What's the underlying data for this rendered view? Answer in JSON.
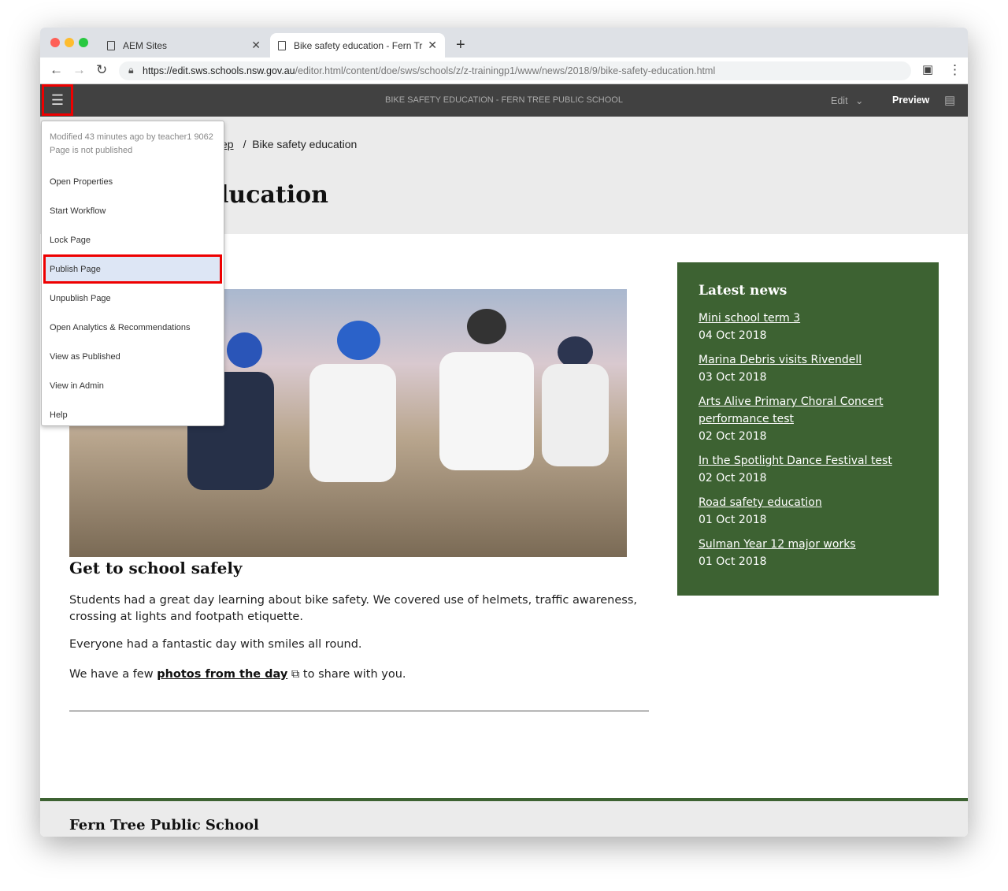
{
  "browser": {
    "tabs": [
      {
        "label": "AEM Sites"
      },
      {
        "label": "Bike safety education - Fern Tr"
      }
    ],
    "url_host": "https://edit.sws.schools.nsw.gov.au",
    "url_path": "/editor.html/content/doe/sws/schools/z/z-trainingp1/www/news/2018/9/bike-safety-education.html"
  },
  "aem": {
    "title": "BIKE SAFETY EDUCATION - FERN TREE PUBLIC SCHOOL",
    "edit_label": "Edit",
    "preview_label": "Preview"
  },
  "page_menu": {
    "modified": "Modified 43 minutes ago by teacher1 9062",
    "status": "Page is not published",
    "items": [
      "Open Properties",
      "Start Workflow",
      "Lock Page",
      "Publish Page",
      "Unpublish Page",
      "Open Analytics & Recommendations",
      "View as Published",
      "View in Admin",
      "Help"
    ]
  },
  "breadcrumb": {
    "parent_partial": "ep",
    "current": "Bike safety education"
  },
  "page": {
    "title_partial": "lucation",
    "subtitle": "Get to school safely",
    "p1": "Students had a great day learning about bike safety. We covered use of helmets, traffic awareness, crossing at lights and footpath etiquette.",
    "p2": "Everyone had a fantastic day with smiles all round.",
    "p3_pre": "We have a few ",
    "p3_link": "photos from the day",
    "p3_post": " to share with you."
  },
  "news": {
    "heading": "Latest news",
    "items": [
      {
        "title": "Mini school term 3",
        "date": "04 Oct 2018"
      },
      {
        "title": "Marina Debris visits Rivendell",
        "date": "03 Oct 2018"
      },
      {
        "title": "Arts Alive Primary Choral Concert performance test",
        "date": "02 Oct 2018"
      },
      {
        "title": "In the Spotlight Dance Festival test",
        "date": "02 Oct 2018"
      },
      {
        "title": "Road safety education",
        "date": "01 Oct 2018"
      },
      {
        "title": "Sulman Year 12 major works",
        "date": "01 Oct 2018"
      }
    ]
  },
  "footer": {
    "school": "Fern Tree Public School"
  },
  "colors": {
    "accent_green": "#3d6232",
    "highlight_red": "#e00000"
  }
}
